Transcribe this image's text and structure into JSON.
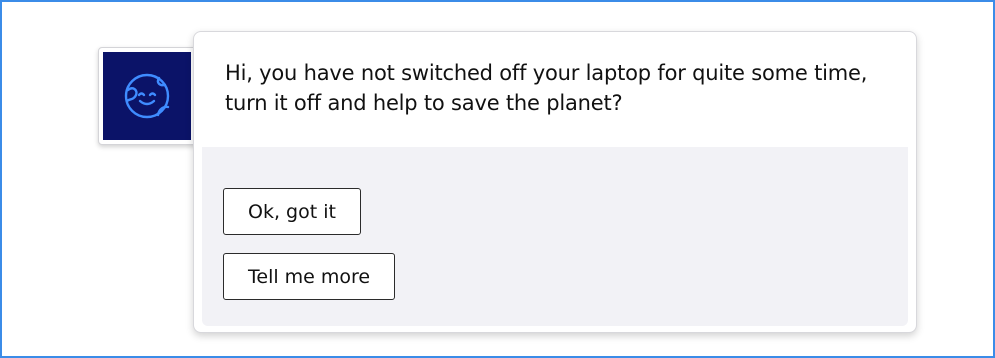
{
  "message": {
    "text": "Hi, you have not switched off your laptop for quite some time, turn it off and help to save the planet?"
  },
  "buttons": {
    "ok_label": "Ok, got it",
    "more_label": "Tell me more"
  },
  "avatar": {
    "icon": "smiling-globe-icon",
    "background": "#0b1368",
    "icon_color": "#3f8cff"
  },
  "colors": {
    "frame_border": "#3b8ce8",
    "actions_background": "#f2f2f6"
  }
}
